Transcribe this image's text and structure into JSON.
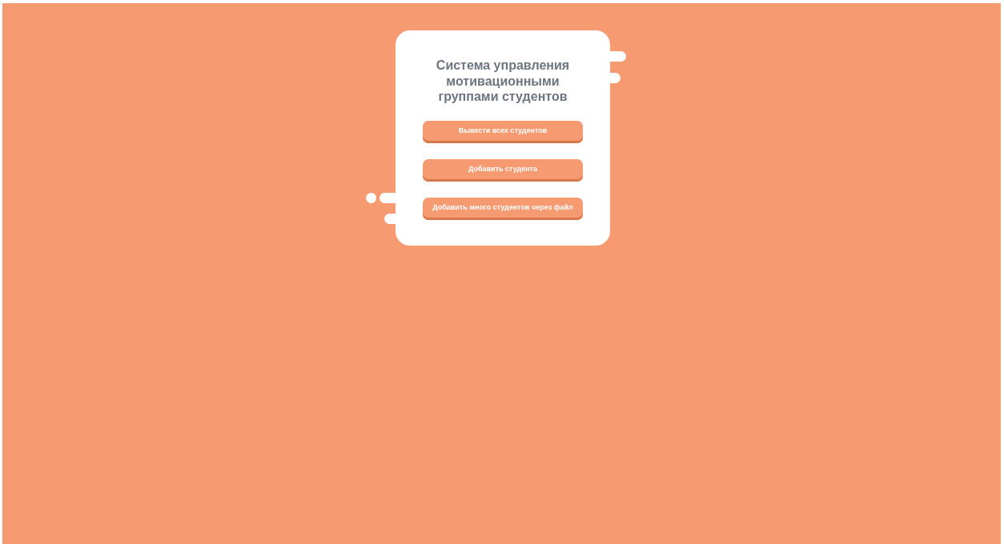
{
  "card": {
    "title": "Система управления мотивационными группами студентов",
    "buttons": [
      "Вывести всех студентов",
      "Добавить студента",
      "Добавить много студентов через файл"
    ]
  }
}
